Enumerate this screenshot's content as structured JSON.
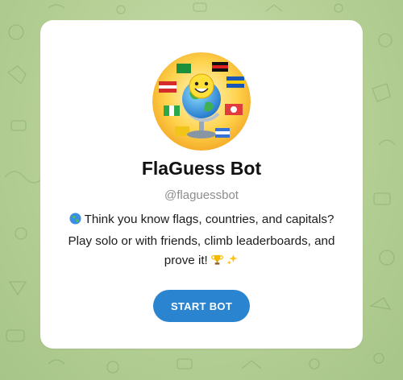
{
  "bot": {
    "name": "FlaGuess Bot",
    "username": "@flaguessbot",
    "avatar_icon": "globe-with-flags-smiley-avatar",
    "description": {
      "line1_text": "Think you know flags, countries, and capitals?",
      "line2_text": "Play solo or with friends, climb leaderboards, and",
      "line3_text": "prove it!",
      "lead_icon": "globe-icon",
      "trail_icons": [
        "trophy-icon",
        "sparkles-icon"
      ]
    }
  },
  "actions": {
    "start_label": "START BOT"
  },
  "colors": {
    "accent": "#2b84cf",
    "background": "#b5cf95",
    "card": "#ffffff",
    "username": "#8c8c8c"
  }
}
